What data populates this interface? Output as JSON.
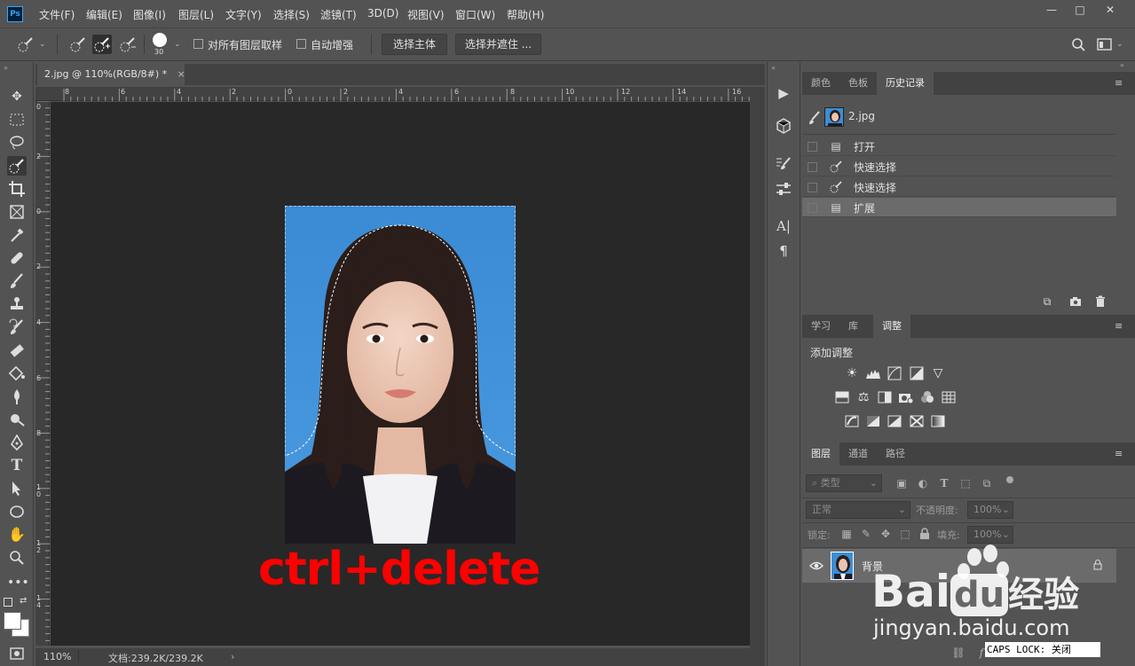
{
  "app": {
    "logo": "Ps"
  },
  "menu": [
    "文件(F)",
    "编辑(E)",
    "图像(I)",
    "图层(L)",
    "文字(Y)",
    "选择(S)",
    "滤镜(T)",
    "3D(D)",
    "视图(V)",
    "窗口(W)",
    "帮助(H)"
  ],
  "window_controls": {
    "minimize": "—",
    "restore": "□",
    "close": "✕"
  },
  "options": {
    "brush_size": "30",
    "sample_all_layers": "对所有图层取样",
    "auto_enhance": "自动增强",
    "select_subject": "选择主体",
    "select_and_mask": "选择并遮住 ..."
  },
  "document": {
    "tab_title": "2.jpg @ 110%(RGB/8#) *",
    "tab_close": "×",
    "zoom": "110%",
    "doc_info": "文档:239.2K/239.2K",
    "ruler_top": [
      "8",
      "6",
      "4",
      "2",
      "0",
      "2",
      "4",
      "6",
      "8",
      "10",
      "12",
      "14",
      "16"
    ],
    "ruler_left": [
      "0",
      "2",
      "0",
      "2",
      "4",
      "6",
      "8",
      "1 0",
      "1 2",
      "1 4"
    ],
    "shortcut_annotation": "ctrl+delete"
  },
  "history_panel": {
    "tabs": [
      "颜色",
      "色板",
      "历史记录"
    ],
    "active_tab": "历史记录",
    "snapshot": "2.jpg",
    "items": [
      {
        "label": "打开",
        "icon": "document-icon"
      },
      {
        "label": "快速选择",
        "icon": "quick-selection-icon"
      },
      {
        "label": "快速选择",
        "icon": "quick-selection-icon"
      },
      {
        "label": "扩展",
        "icon": "document-icon"
      }
    ]
  },
  "adjustments_panel": {
    "tabs": [
      "学习",
      "库",
      "调整"
    ],
    "active_tab": "调整",
    "title": "添加调整"
  },
  "layers_panel": {
    "tabs": [
      "图层",
      "通道",
      "路径"
    ],
    "active_tab": "图层",
    "filter_kind": "类型",
    "blend_mode": "正常",
    "opacity_label": "不透明度:",
    "opacity_value": "100%",
    "lock_label": "锁定:",
    "fill_label": "填充:",
    "fill_value": "100%",
    "layers": [
      {
        "name": "背景"
      }
    ]
  },
  "watermark": {
    "brand": "Bai",
    "brand2": "du",
    "brand_cn": "经验",
    "url": "jingyan.baidu.com"
  },
  "caps_lock": "CAPS LOCK: 关闭",
  "colors": {
    "ui_bg": "#535353",
    "canvas": "#282828",
    "photo_bg": "#3b8ed6",
    "annotation": "#ff0000"
  }
}
